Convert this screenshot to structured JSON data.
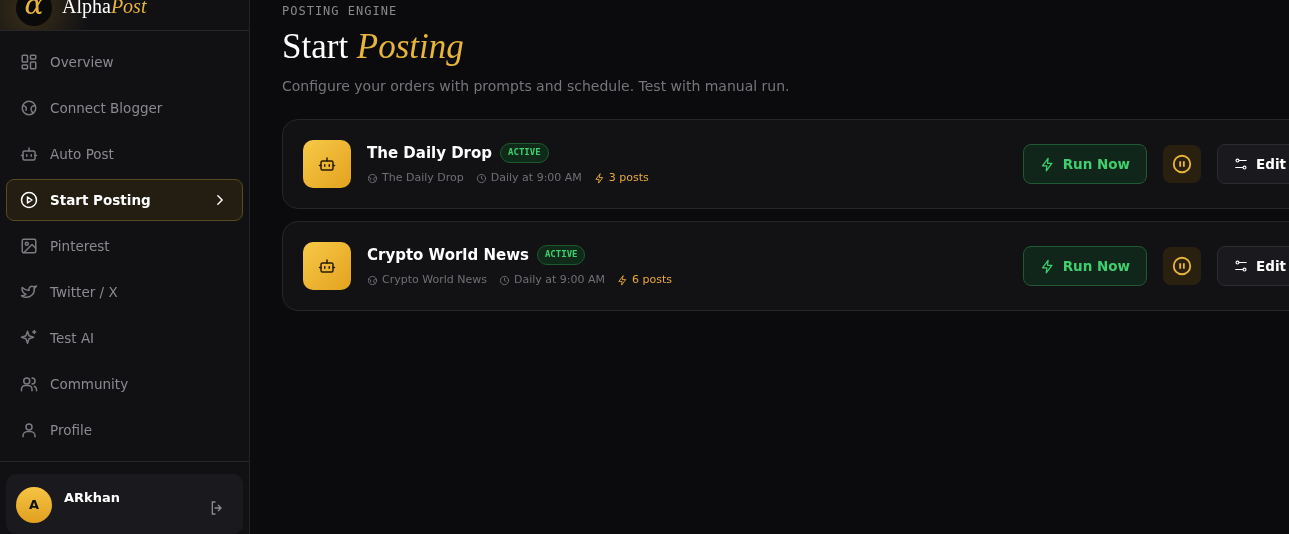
{
  "brand": {
    "mark": "α",
    "name": "Alpha",
    "accent": "Post"
  },
  "sidebar": {
    "items": [
      {
        "label": "Overview",
        "selected": false
      },
      {
        "label": "Connect Blogger",
        "selected": false
      },
      {
        "label": "Auto Post",
        "selected": false
      },
      {
        "label": "Start Posting",
        "selected": true
      },
      {
        "label": "Pinterest",
        "selected": false
      },
      {
        "label": "Twitter / X",
        "selected": false
      },
      {
        "label": "Test AI",
        "selected": false
      },
      {
        "label": "Community",
        "selected": false
      },
      {
        "label": "Profile",
        "selected": false
      }
    ],
    "user": {
      "initial": "A",
      "name": "ARkhan"
    }
  },
  "header": {
    "eyebrow": "POSTING ENGINE",
    "title": "Start *Posting*",
    "subtitle": "Configure your orders with prompts and schedule. Test with manual run."
  },
  "orders": [
    {
      "name": "The Daily Drop",
      "status": "ACTIVE",
      "blog": "The Daily Drop",
      "schedule": "Daily at 9:00 AM",
      "posts": "3 posts",
      "actions": {
        "run": "Run Now",
        "edit": "Edit"
      }
    },
    {
      "name": "Crypto World News",
      "status": "ACTIVE",
      "blog": "Crypto World News",
      "schedule": "Daily at 9:00 AM",
      "posts": "6 posts",
      "actions": {
        "run": "Run Now",
        "edit": "Edit"
      }
    }
  ]
}
